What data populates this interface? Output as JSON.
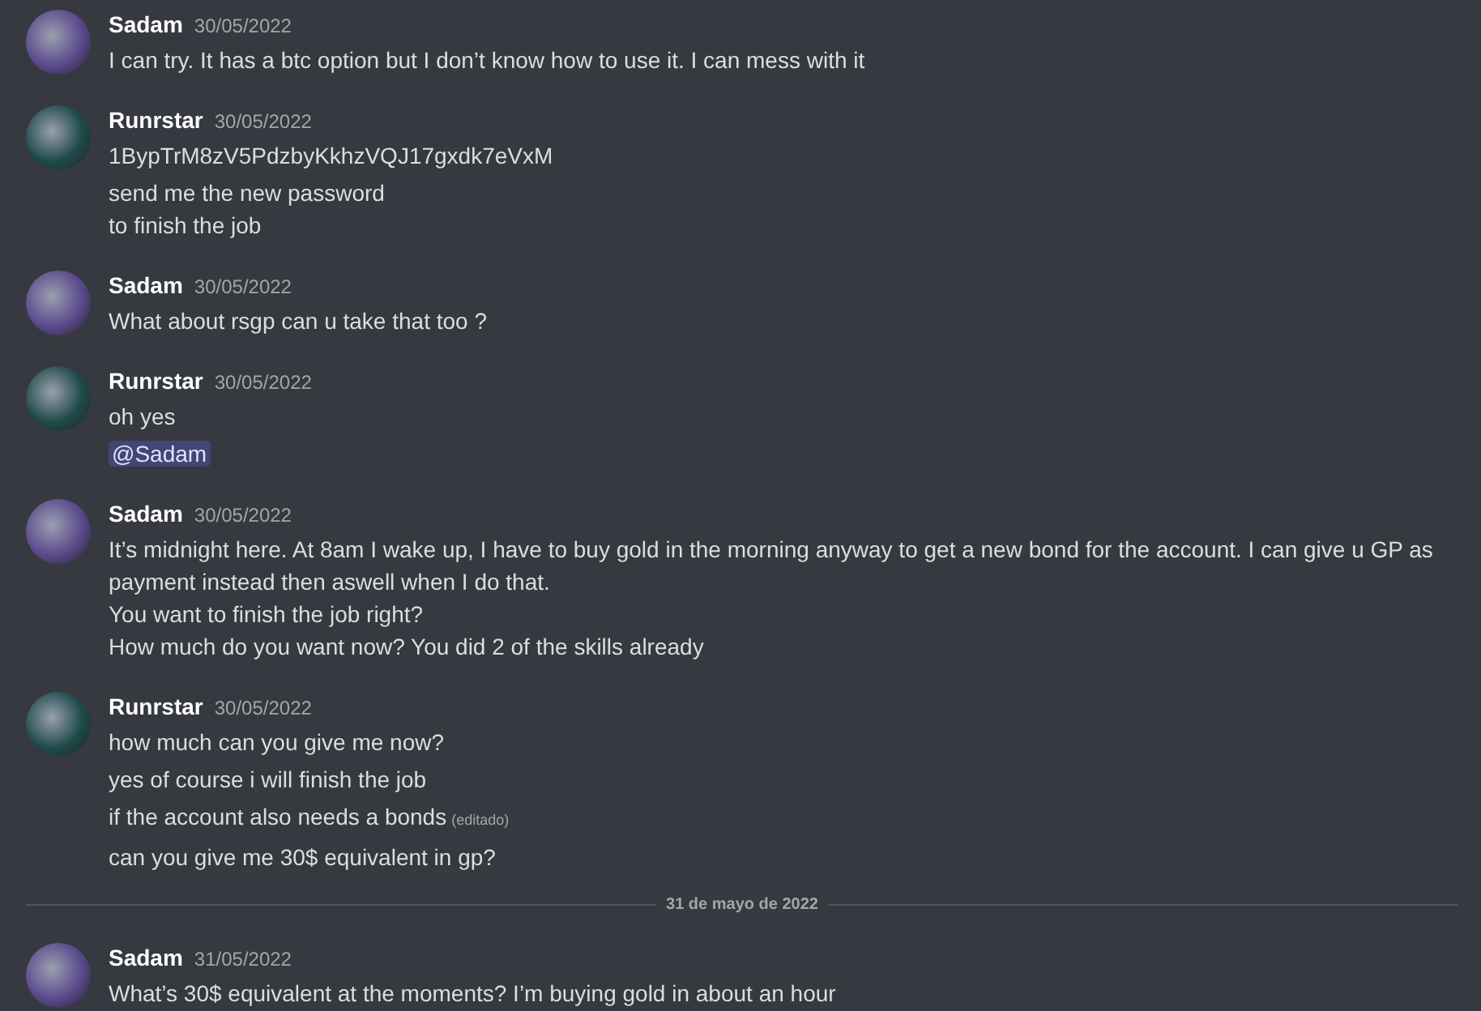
{
  "messages": [
    {
      "kind": "group",
      "author": "Sadam",
      "time": "30/05/2022",
      "color": "#5b4a8c",
      "lines": [
        {
          "kind": "text",
          "text": "I can try. It has a btc option but I don’t know how to use it. I can mess with it"
        }
      ]
    },
    {
      "kind": "group",
      "author": "Runrstar",
      "time": "30/05/2022",
      "color": "#1f4a4a",
      "lines": [
        {
          "kind": "text",
          "text": "1BypTrM8zV5PdzbyKkhzVQJ17gxdk7eVxM"
        },
        {
          "kind": "text",
          "text": "send me the new password\nto finish the job"
        }
      ]
    },
    {
      "kind": "group",
      "author": "Sadam",
      "time": "30/05/2022",
      "color": "#5b4a8c",
      "lines": [
        {
          "kind": "text",
          "text": "What about rsgp can u take that too ?"
        }
      ]
    },
    {
      "kind": "group",
      "author": "Runrstar",
      "time": "30/05/2022",
      "color": "#1f4a4a",
      "lines": [
        {
          "kind": "text",
          "text": "oh yes"
        },
        {
          "kind": "mention",
          "text": "@Sadam"
        }
      ]
    },
    {
      "kind": "group",
      "author": "Sadam",
      "time": "30/05/2022",
      "color": "#5b4a8c",
      "lines": [
        {
          "kind": "text",
          "text": "It’s midnight here. At 8am I wake up, I have to buy gold in the morning anyway to get a new bond for the account. I can give u GP as payment instead then aswell when I do that.\nYou want to finish the job right?\nHow much do you want now? You did 2 of the skills already"
        }
      ]
    },
    {
      "kind": "group",
      "author": "Runrstar",
      "time": "30/05/2022",
      "color": "#1f4a4a",
      "lines": [
        {
          "kind": "text",
          "text": "how much can you give me now?"
        },
        {
          "kind": "text",
          "text": "yes of course i will finish the job"
        },
        {
          "kind": "text",
          "text": "if the account also needs a bonds",
          "edited_label": "(editado)"
        },
        {
          "kind": "text",
          "text": "can you give me 30$ equivalent in gp?"
        }
      ]
    },
    {
      "kind": "divider",
      "text": "31 de mayo de 2022"
    },
    {
      "kind": "group",
      "author": "Sadam",
      "time": "31/05/2022",
      "color": "#5b4a8c",
      "lines": [
        {
          "kind": "text",
          "text": "What’s 30$ equivalent at the moments? I’m buying gold in about an hour"
        }
      ]
    }
  ]
}
